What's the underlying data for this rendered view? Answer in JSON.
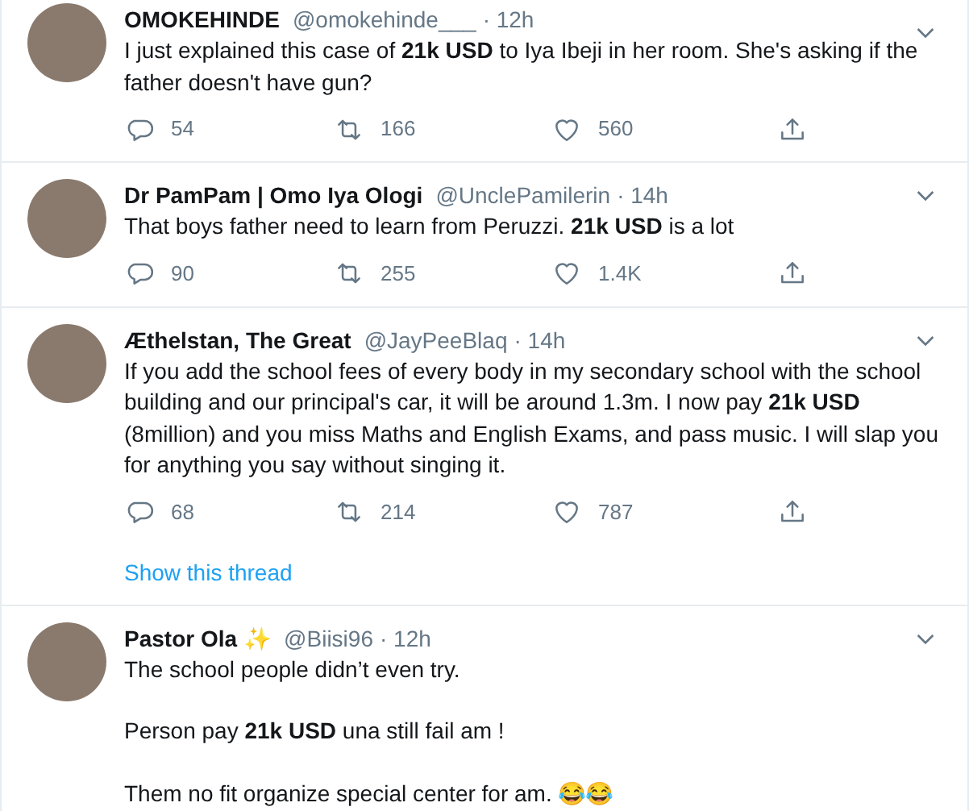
{
  "tweets": [
    {
      "name": "OMOKEHINDE",
      "handle": "@omokehinde___",
      "time": "· 12h",
      "paragraphs": [
        "I just explained this case of **21k USD** to Iya Ibeji in her room. She's asking if the father doesn't have gun?"
      ],
      "replies": "54",
      "retweets": "166",
      "likes": "560"
    },
    {
      "name": "Dr PamPam | Omo Iya Ologi",
      "handle": "@UnclePamilerin",
      "time": "· 14h",
      "paragraphs": [
        "That boys father need to learn from Peruzzi. **21k USD** is a lot"
      ],
      "replies": "90",
      "retweets": "255",
      "likes": "1.4K"
    },
    {
      "name": "Æthelstan, The Great",
      "handle": "@JayPeeBlaq",
      "time": "· 14h",
      "paragraphs": [
        "If you add the school fees of every body in my secondary school with the school building and our principal's car, it will be around 1.3m. I now pay **21k USD** (8million) and you miss Maths and English Exams, and pass music. I will slap you for anything you say without singing it."
      ],
      "replies": "68",
      "retweets": "214",
      "likes": "787",
      "show_thread": "Show this thread"
    },
    {
      "name": "Pastor Ola",
      "badge": "✨",
      "handle": "@Biisi96",
      "time": "· 12h",
      "paragraphs": [
        "The school people didn’t even try.",
        "Person pay **21k USD** una still fail am !",
        "Them no fit organize special center  for am. 😂😂"
      ]
    }
  ]
}
